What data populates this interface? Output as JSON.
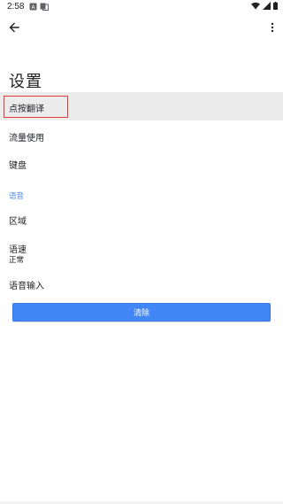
{
  "status_bar": {
    "time": "2:58",
    "icons_left": [
      "notification-a-icon",
      "translate-notification-icon"
    ],
    "icons_right": [
      "wifi-icon",
      "signal-icon",
      "battery-icon"
    ]
  },
  "toolbar": {
    "back_icon": "arrow-back-icon",
    "more_icon": "more-vert-icon"
  },
  "page": {
    "title": "设置"
  },
  "settings": {
    "items": [
      {
        "label": "点按翻译",
        "highlighted": true
      },
      {
        "label": "流量使用"
      },
      {
        "label": "键盘"
      }
    ],
    "voice_section": {
      "header": "语音",
      "items": [
        {
          "label": "区域"
        },
        {
          "label": "语速",
          "value": "正常"
        },
        {
          "label": "语音输入"
        }
      ]
    },
    "clear_button": "清除"
  },
  "colors": {
    "accent": "#4285f4",
    "highlight_border": "#e53935",
    "selected_row_bg": "#ececec",
    "text": "#202124"
  }
}
